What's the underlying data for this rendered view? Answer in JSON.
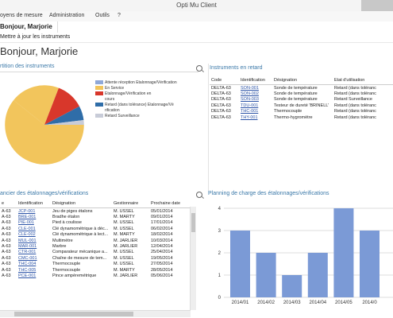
{
  "window": {
    "title": "Opti Mu Client"
  },
  "menu": {
    "items": [
      "oyens de mesure",
      "Administration",
      "Outils",
      "?"
    ]
  },
  "tab": {
    "label": "Bonjour, Marjorie"
  },
  "toolbar": {
    "label": "Mettre à jour les instruments"
  },
  "page": {
    "title": "Bonjour, Marjorie"
  },
  "pie": {
    "title": "rtition des instruments",
    "legend": [
      {
        "label": "Attente réception Etalonnage/Vérification",
        "color": "#8fa8d8"
      },
      {
        "label": "En Service",
        "color": "#f2c55c"
      },
      {
        "label": "Etalonnage/Vérification en",
        "color": "#d8372b"
      },
      {
        "label": "cours",
        "color": ""
      },
      {
        "label": "Retard (dans tolérance) Etalonnage/Vé",
        "color": "#2f6da8"
      },
      {
        "label": "rification",
        "color": ""
      },
      {
        "label": "Retard Surveillance",
        "color": "#c8ccd8"
      }
    ]
  },
  "retard": {
    "title": "Instruments en retard",
    "columns": [
      "Code",
      "Identification",
      "Désignation",
      "Etat d'utilisation"
    ],
    "rows": [
      [
        "DELTA-63",
        "SON-001",
        "Sonde de température",
        "Retard (dans toléranc"
      ],
      [
        "DELTA-63",
        "SON-002",
        "Sonde de température",
        "Retard (dans toléranc"
      ],
      [
        "DELTA-63",
        "SON-003",
        "Sonde de température",
        "Retard Surveillance"
      ],
      [
        "DELTA-63",
        "TDU-001",
        "Testeur de dureté 'BRINELL'",
        "Retard (dans toléranc"
      ],
      [
        "DELTA-63",
        "THC-001",
        "Thermocouple",
        "Retard (dans toléranc"
      ],
      [
        "DELTA-63",
        "THY-001",
        "Thermo-hygromètre",
        "Retard (dans toléranc"
      ]
    ]
  },
  "calendar": {
    "title": "ancier des étalonnages/vérifications",
    "columns": [
      "e",
      "Identification",
      "Désignation",
      "Gestionnaire",
      "Prochaine date"
    ],
    "rows": [
      [
        "A-63",
        "JCP-001",
        "Jeu de piges étalons",
        "M. USSEL",
        "05/01/2014"
      ],
      [
        "A-63",
        "BRE-001",
        "Bradhe étalon",
        "M. MARTY",
        "09/01/2014"
      ],
      [
        "A-63",
        "PIE-001",
        "Pied à coulisse",
        "M. USSEL",
        "17/01/2014"
      ],
      [
        "A-63",
        "CLE-001",
        "Clé dynamométrique à déc...",
        "M. USSEL",
        "06/02/2014"
      ],
      [
        "A-63",
        "CLE-002",
        "Clé dynamométrique à lect...",
        "M. MARTY",
        "18/02/2014"
      ],
      [
        "A-63",
        "MUL-001",
        "Multimètre",
        "M. JARLIER",
        "10/03/2014"
      ],
      [
        "A-63",
        "MAR-001",
        "Marbre",
        "M. JARLIER",
        "12/04/2014"
      ],
      [
        "A-63",
        "CTR-001",
        "Comparateur mécanique a...",
        "M. USSEL",
        "25/04/2014"
      ],
      [
        "A-63",
        "CMC-001",
        "Chaîne de mesure de tem...",
        "M. USSEL",
        "19/05/2014"
      ],
      [
        "A-63",
        "THC-004",
        "Thermocouple",
        "M. USSEL",
        "27/05/2014"
      ],
      [
        "A-63",
        "THC-005",
        "Thermocouple",
        "M. MARTY",
        "28/05/2014"
      ],
      [
        "A-63",
        "PCE-001",
        "Pince ampèremétrique",
        "M. JARLIER",
        "05/06/2014"
      ]
    ]
  },
  "chart_data": {
    "type": "bar",
    "title": "Planning de charge des étalonnages/vérifications",
    "categories": [
      "2014/01",
      "2014/02",
      "2014/03",
      "2014/04",
      "2014/05",
      "2014/0"
    ],
    "values": [
      3,
      2,
      1,
      2,
      4,
      3
    ],
    "ylim": [
      0,
      4
    ],
    "yticks": [
      "0",
      "1",
      "2",
      "3",
      "4"
    ],
    "color": "#7b9ad6"
  }
}
